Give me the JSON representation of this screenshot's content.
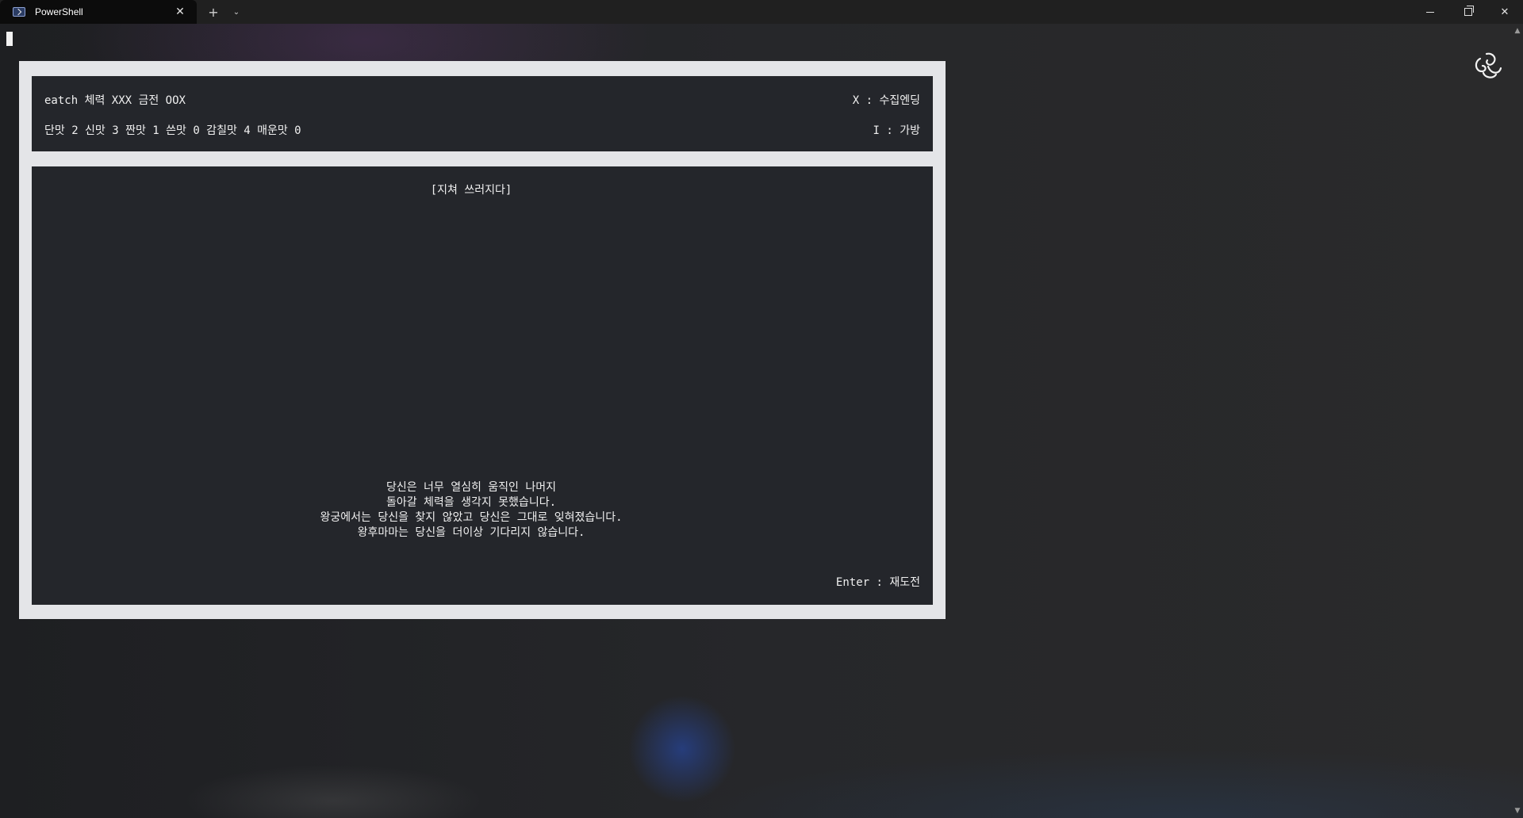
{
  "tab": {
    "title": "PowerShell",
    "close_glyph": "✕",
    "new_tab_glyph": "+",
    "dropdown_glyph": "⌄"
  },
  "window_controls": {
    "close_glyph": "✕"
  },
  "scrollbar": {
    "up_glyph": "▲",
    "down_glyph": "▼"
  },
  "game": {
    "status": {
      "line1": "eatch 체력 XXX 금전 OOX",
      "line2": "단맛 2 신맛 3 짠맛 1 쓴맛 0 감칠맛 4 매운맛 0",
      "key_hint_1": "X : 수집엔딩",
      "key_hint_2": "I : 가방"
    },
    "scene_title": "[지쳐 쓰러지다]",
    "story_lines": [
      "당신은 너무 열심히 움직인 나머지",
      "돌아갈 체력을 생각지 못했습니다.",
      "왕궁에서는 당신을 찾지 않았고 당신은 그대로 잊혀졌습니다.",
      "왕후마마는 당신을 더이상 기다리지 않습니다."
    ],
    "enter_hint": "Enter : 재도전"
  },
  "colors": {
    "frame": "#e4e5e8",
    "panel": "#16181c",
    "text": "#f0f0f0"
  }
}
